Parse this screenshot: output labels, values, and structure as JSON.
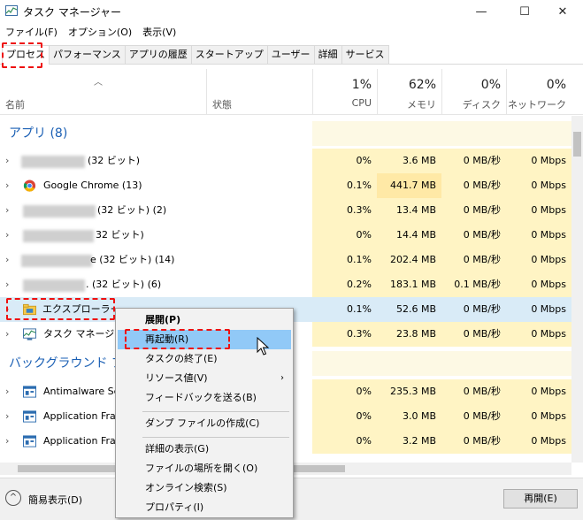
{
  "window": {
    "title": "タスク マネージャー",
    "minimize": "—",
    "maximize": "☐",
    "close": "✕"
  },
  "menu": [
    "ファイル(F)",
    "オプション(O)",
    "表示(V)"
  ],
  "tabs": [
    "プロセス",
    "パフォーマンス",
    "アプリの履歴",
    "スタートアップ",
    "ユーザー",
    "詳細",
    "サービス"
  ],
  "header": {
    "name": "名前",
    "status": "状態",
    "columns": [
      {
        "pct": "1%",
        "name": "CPU"
      },
      {
        "pct": "62%",
        "name": "メモリ"
      },
      {
        "pct": "0%",
        "name": "ディスク"
      },
      {
        "pct": "0%",
        "name": "ネットワーク"
      }
    ]
  },
  "groups": {
    "apps": "アプリ (8)",
    "background": "バックグラウンド プロ"
  },
  "rows": [
    {
      "name": "(32 ビット)",
      "cpu": "0%",
      "mem": "3.6 MB",
      "disk": "0 MB/秒",
      "net": "0 Mbps"
    },
    {
      "name": "Google Chrome (13)",
      "cpu": "0.1%",
      "mem": "441.7 MB",
      "disk": "0 MB/秒",
      "net": "0 Mbps"
    },
    {
      "name": "(32 ビット) (2)",
      "cpu": "0.3%",
      "mem": "13.4 MB",
      "disk": "0 MB/秒",
      "net": "0 Mbps"
    },
    {
      "name": "32 ビット)",
      "cpu": "0%",
      "mem": "14.4 MB",
      "disk": "0 MB/秒",
      "net": "0 Mbps"
    },
    {
      "name": "e (32 ビット) (14)",
      "cpu": "0.1%",
      "mem": "202.4 MB",
      "disk": "0 MB/秒",
      "net": "0 Mbps"
    },
    {
      "name": ". (32 ビット) (6)",
      "cpu": "0.2%",
      "mem": "183.1 MB",
      "disk": "0.1 MB/秒",
      "net": "0 Mbps"
    },
    {
      "name": "エクスプローラー",
      "cpu": "0.1%",
      "mem": "52.6 MB",
      "disk": "0 MB/秒",
      "net": "0 Mbps"
    },
    {
      "name": "タスク マネージャー",
      "cpu": "0.3%",
      "mem": "23.8 MB",
      "disk": "0 MB/秒",
      "net": "0 Mbps"
    },
    {
      "name": "Antimalware Se",
      "cpu": "0%",
      "mem": "235.3 MB",
      "disk": "0 MB/秒",
      "net": "0 Mbps"
    },
    {
      "name": "Application Fra",
      "cpu": "0%",
      "mem": "3.0 MB",
      "disk": "0 MB/秒",
      "net": "0 Mbps"
    },
    {
      "name": "Application Fra",
      "cpu": "0%",
      "mem": "3.2 MB",
      "disk": "0 MB/秒",
      "net": "0 Mbps"
    }
  ],
  "context_menu": {
    "items": [
      "展開(P)",
      "再起動(R)",
      "タスクの終了(E)",
      "リソース値(V)",
      "フィードバックを送る(B)",
      "ダンプ ファイルの作成(C)",
      "詳細の表示(G)",
      "ファイルの場所を開く(O)",
      "オンライン検索(S)",
      "プロパティ(I)"
    ],
    "submenu_arrow": "›"
  },
  "footer": {
    "fewer_details": "簡易表示(D)",
    "fewer_icon": "^",
    "restart": "再開(E)"
  },
  "colors": {
    "heat_light": "#fff4c4",
    "heat_medium": "#ffe9a6",
    "highlight": "#91c9f7",
    "annotation": "#ee1111",
    "group_title": "#1a5fb4"
  }
}
